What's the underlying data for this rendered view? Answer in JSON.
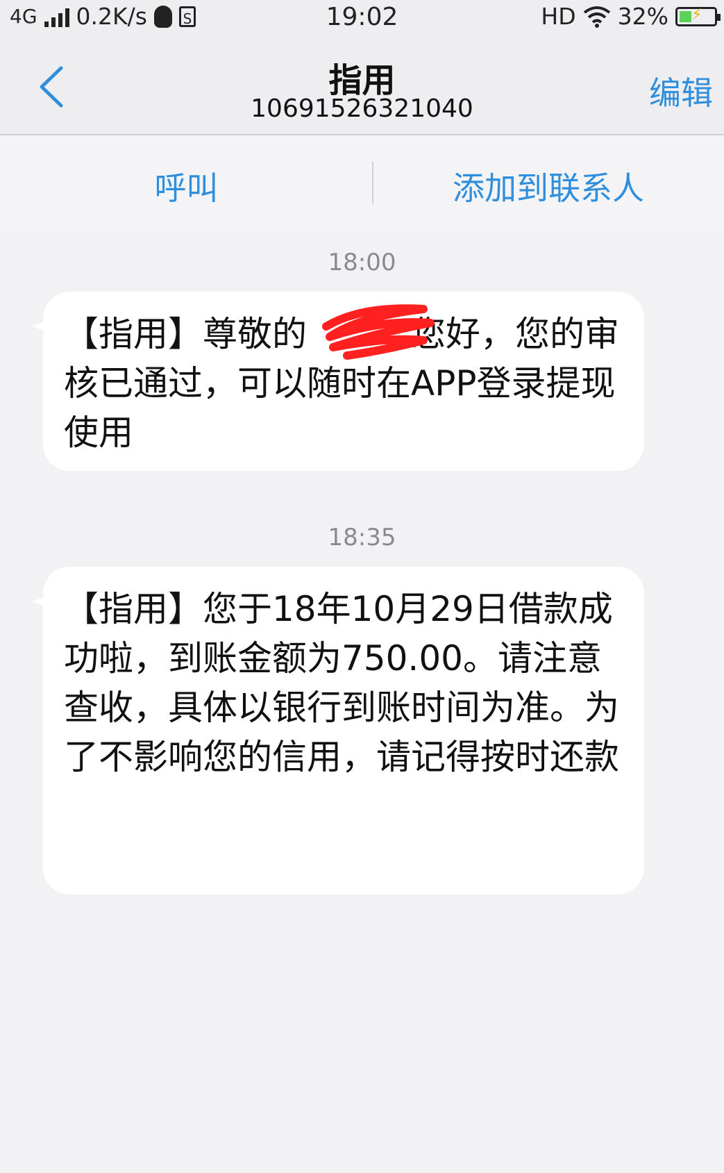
{
  "status_bar": {
    "network": "4G",
    "speed": "0.2K/s",
    "sim_icon_label": "S",
    "time": "19:02",
    "hd": "HD",
    "battery": "32%",
    "battery_level": 0.32
  },
  "header": {
    "title": "指用",
    "number": "10691526321040",
    "edit_label": "编辑"
  },
  "actions": {
    "call_label": "呼叫",
    "add_contact_label": "添加到联系人"
  },
  "messages": [
    {
      "time": "18:00",
      "text": "【指用】尊敬的　　　您好，您的审核已通过，可以随时在APP登录提现使用"
    },
    {
      "time": "18:35",
      "text": "【指用】您于18年10月29日借款成功啦，到账金额为750.00。请注意查收，具体以银行到账时间为准。为了不影响您的信用，请记得按时还款"
    }
  ],
  "colors": {
    "accent": "#2f8fdc",
    "redaction": "#ff2020"
  }
}
